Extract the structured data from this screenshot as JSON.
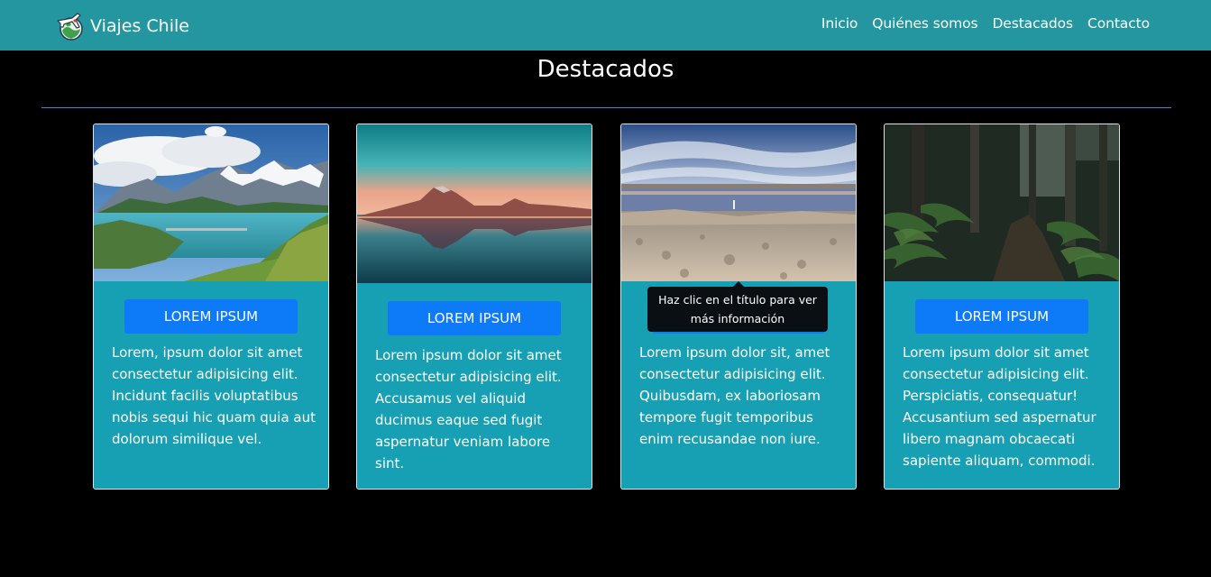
{
  "navbar": {
    "brand": "Viajes Chile",
    "links": [
      "Inicio",
      "Quiénes somos",
      "Destacados",
      "Contacto"
    ]
  },
  "section": {
    "title": "Destacados"
  },
  "cards": [
    {
      "button": "LOREM IPSUM",
      "text": "Lorem, ipsum dolor sit amet consectetur adipisicing elit. Incidunt facilis voluptatibus nobis sequi hic quam quia aut dolorum similique vel."
    },
    {
      "button": "LOREM IPSUM",
      "text": "Lorem ipsum dolor sit amet consectetur adipisicing elit. Accusamus vel aliquid ducimus eaque sed fugit aspernatur veniam labore sint."
    },
    {
      "button": "LOREM IPSUM",
      "text": "Lorem ipsum dolor sit, amet consectetur adipisicing elit. Quibusdam, ex laboriosam tempore fugit temporibus enim recusandae non iure."
    },
    {
      "button": "LOREM IPSUM",
      "text": "Lorem ipsum dolor sit amet consectetur adipisicing elit. Perspiciatis, consequatur! Accusantium sed aspernatur libero magnam obcaecati sapiente aliquam, commodi."
    }
  ],
  "tooltip": {
    "line1": "Haz clic en el título para ver",
    "line2": "más información"
  },
  "colors": {
    "navbar": "#23969f",
    "card": "#17a0b3",
    "button": "#0d7af8",
    "background": "#000000"
  }
}
